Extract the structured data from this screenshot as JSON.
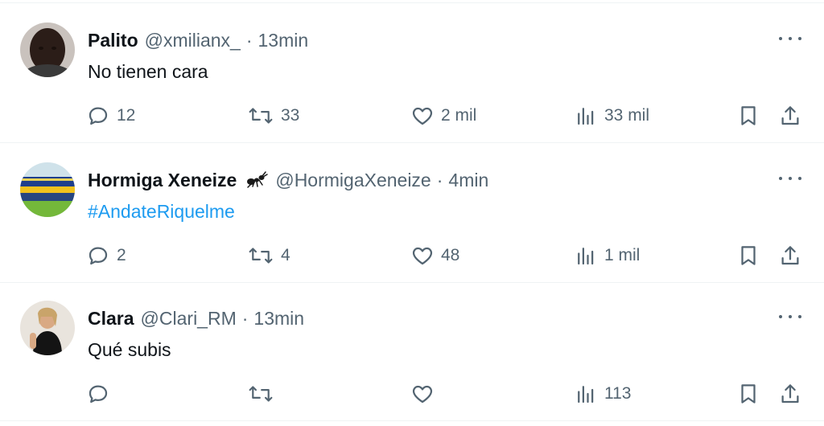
{
  "tweets": [
    {
      "display_name": "Palito",
      "handle": "@xmilianx_",
      "separator": "·",
      "time": "13min",
      "text": "No tienen cara",
      "hashtag": "",
      "badge": "",
      "avatar": "avatar-dark-portrait",
      "replies": "12",
      "retweets": "33",
      "likes": "2 mil",
      "views": "33 mil"
    },
    {
      "display_name": "Hormiga Xeneize",
      "handle": "@HormigaXeneize",
      "separator": "·",
      "time": "4min",
      "text": "",
      "hashtag": "#AndateRiquelme",
      "badge": "ant-icon",
      "avatar": "avatar-stadium",
      "replies": "2",
      "retweets": "4",
      "likes": "48",
      "views": "1 mil"
    },
    {
      "display_name": "Clara",
      "handle": "@Clari_RM",
      "separator": "·",
      "time": "13min",
      "text": "Qué subis",
      "hashtag": "",
      "badge": "",
      "avatar": "avatar-photo",
      "replies": "",
      "retweets": "",
      "likes": "",
      "views": "113"
    }
  ],
  "colors": {
    "text_primary": "#0f1419",
    "text_secondary": "#536471",
    "link": "#1d9bf0",
    "divider": "#eff3f4"
  }
}
